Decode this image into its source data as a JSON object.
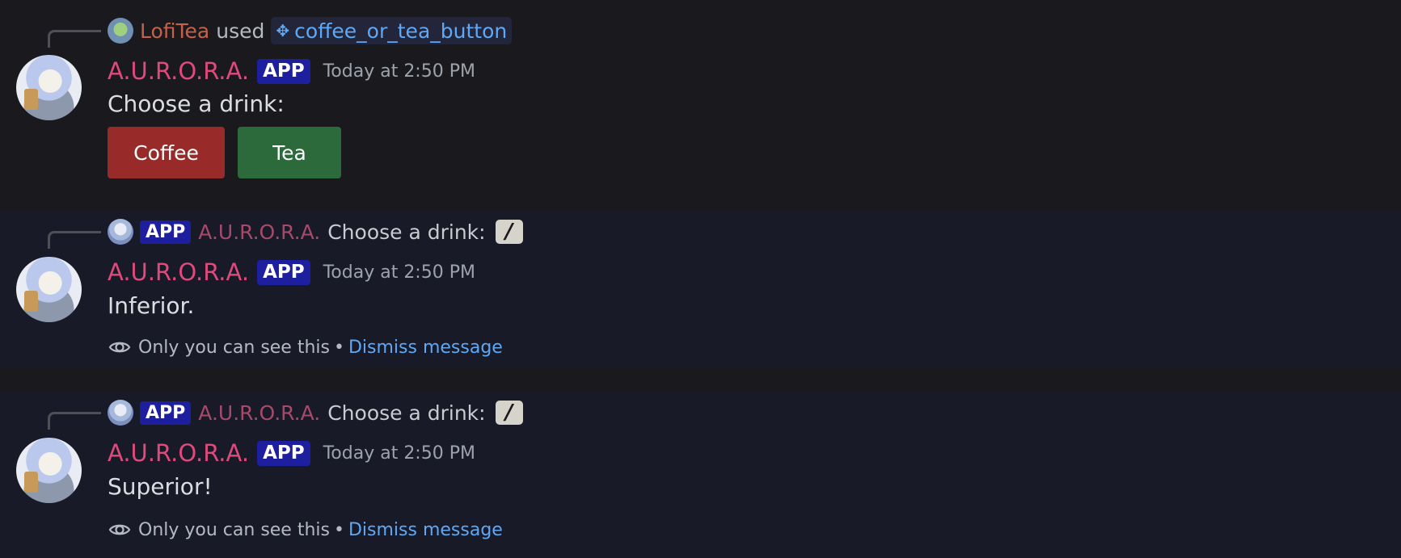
{
  "bot": {
    "name": "A.U.R.O.R.A.",
    "badge": "APP",
    "name_color": "#e0497b",
    "badge_color": "#1d1f9e"
  },
  "messages": [
    {
      "reply": {
        "user": "LofiTea",
        "used_text": "used",
        "command_icon": "slash-command-icon",
        "command": "coffee_or_tea_button"
      },
      "timestamp": "Today at 2:50 PM",
      "content": "Choose a drink:",
      "buttons": [
        {
          "label": "Coffee",
          "color": "#992a2a"
        },
        {
          "label": "Tea",
          "color": "#2c6a3b"
        }
      ]
    },
    {
      "reply": {
        "badge": "APP",
        "author": "A.U.R.O.R.A.",
        "content": "Choose a drink:",
        "slash_icon": "slash-icon"
      },
      "timestamp": "Today at 2:50 PM",
      "content": "Inferior.",
      "notice": {
        "text": "Only you can see this",
        "separator": "•",
        "dismiss": "Dismiss message"
      }
    },
    {
      "reply": {
        "badge": "APP",
        "author": "A.U.R.O.R.A.",
        "content": "Choose a drink:",
        "slash_icon": "slash-icon"
      },
      "timestamp": "Today at 2:50 PM",
      "content": "Superior!",
      "notice": {
        "text": "Only you can see this",
        "separator": "•",
        "dismiss": "Dismiss message"
      }
    }
  ]
}
